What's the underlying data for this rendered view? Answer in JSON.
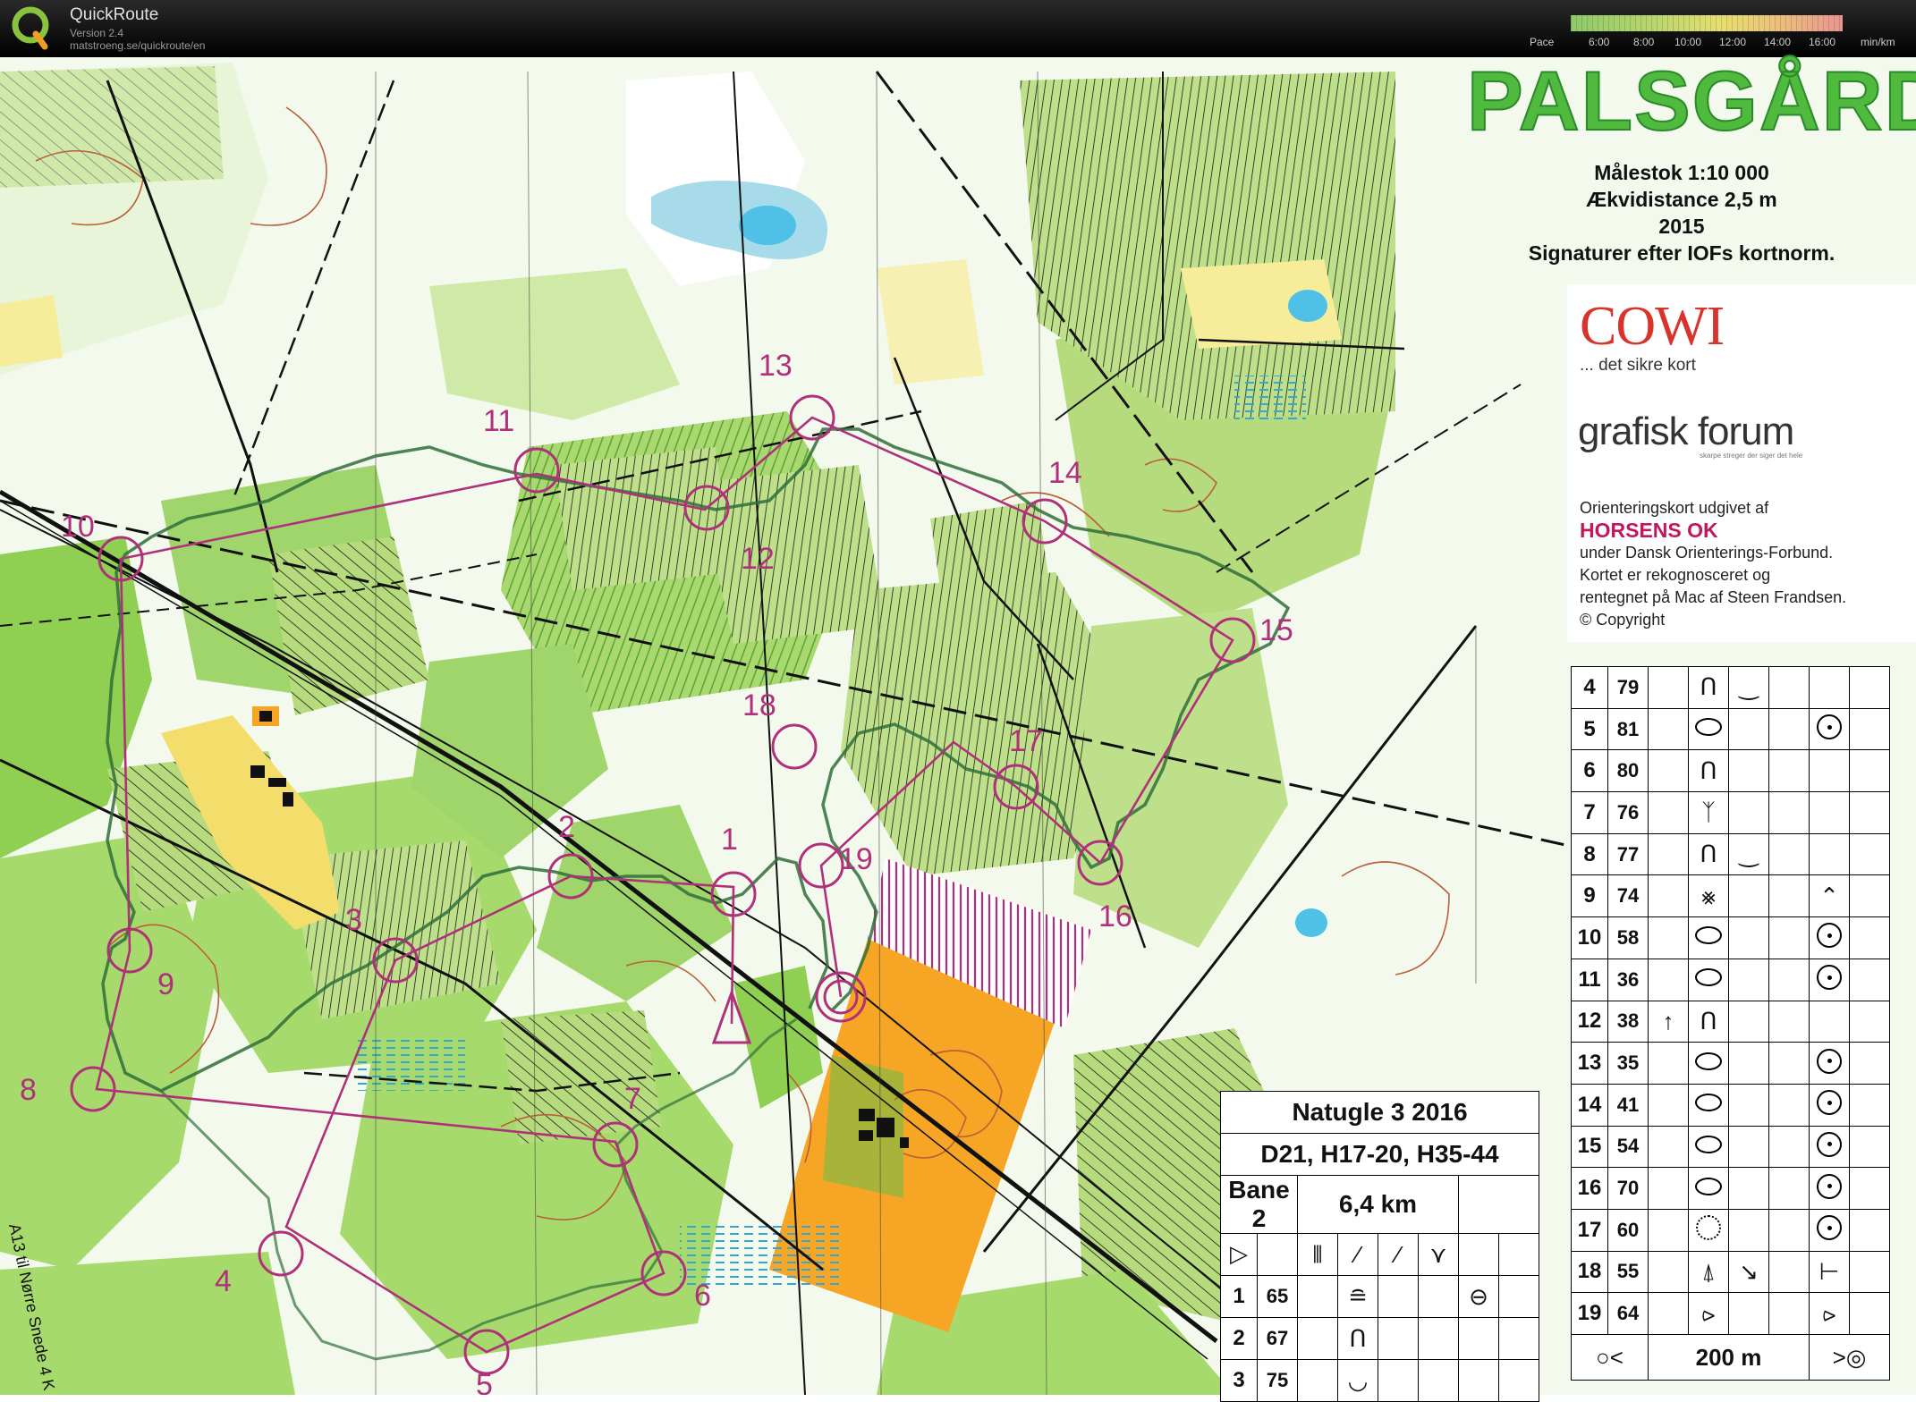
{
  "app": {
    "title": "QuickRoute",
    "version": "Version 2.4",
    "url": "matstroeng.se/quickroute/en",
    "pace_label": "Pace",
    "pace_ticks": [
      "6:00",
      "8:00",
      "10:00",
      "12:00",
      "14:00",
      "16:00"
    ],
    "pace_unit": "min/km"
  },
  "map_info": {
    "name": "PALSGÅRD",
    "scale": "Målestok 1:10 000",
    "contour": "Ækvidistance 2,5 m",
    "year": "2015",
    "norm": "Signaturer efter IOFs kortnorm.",
    "sponsor1": "COWI",
    "sponsor1_tag": "... det sikre kort",
    "sponsor2": "grafisk forum",
    "sponsor2_tag": "skarpe streger der siger det hele",
    "info_line1": "Orienteringskort udgivet af",
    "club": "HORSENS OK",
    "info_line2": "under Dansk Orienterings-Forbund.",
    "info_line3": "Kortet er rekognosceret og",
    "info_line4": "rentegnet på Mac af Steen Frandsen.",
    "copyright": "© Copyright",
    "road_label": "A13 til Nørre Snede 4 K"
  },
  "course": {
    "event": "Natugle 3 2016",
    "classes": "D21, H17-20, H35-44",
    "course_name": "Bane 2",
    "length": "6,4 km",
    "finish_distance": "200 m",
    "controls": [
      {
        "n": "1",
        "code": "65"
      },
      {
        "n": "2",
        "code": "67"
      },
      {
        "n": "3",
        "code": "75"
      },
      {
        "n": "4",
        "code": "79"
      },
      {
        "n": "5",
        "code": "81"
      },
      {
        "n": "6",
        "code": "80"
      },
      {
        "n": "7",
        "code": "76"
      },
      {
        "n": "8",
        "code": "77"
      },
      {
        "n": "9",
        "code": "74"
      },
      {
        "n": "10",
        "code": "58"
      },
      {
        "n": "11",
        "code": "36"
      },
      {
        "n": "12",
        "code": "38"
      },
      {
        "n": "13",
        "code": "35"
      },
      {
        "n": "14",
        "code": "41"
      },
      {
        "n": "15",
        "code": "54"
      },
      {
        "n": "16",
        "code": "70"
      },
      {
        "n": "17",
        "code": "60"
      },
      {
        "n": "18",
        "code": "55"
      },
      {
        "n": "19",
        "code": "64"
      }
    ],
    "map_labels": [
      "1",
      "2",
      "3",
      "4",
      "5",
      "6",
      "7",
      "8",
      "9",
      "10",
      "11",
      "12",
      "13",
      "14",
      "15",
      "16",
      "17",
      "18",
      "19"
    ]
  },
  "colors": {
    "course_magenta": "#b0307a",
    "forest_green": "#9fd56a",
    "dense_green": "#6cbf3e",
    "open_yellow": "#f6e06a",
    "orange_field": "#f7a524",
    "route_green": "#2f6f3a"
  }
}
